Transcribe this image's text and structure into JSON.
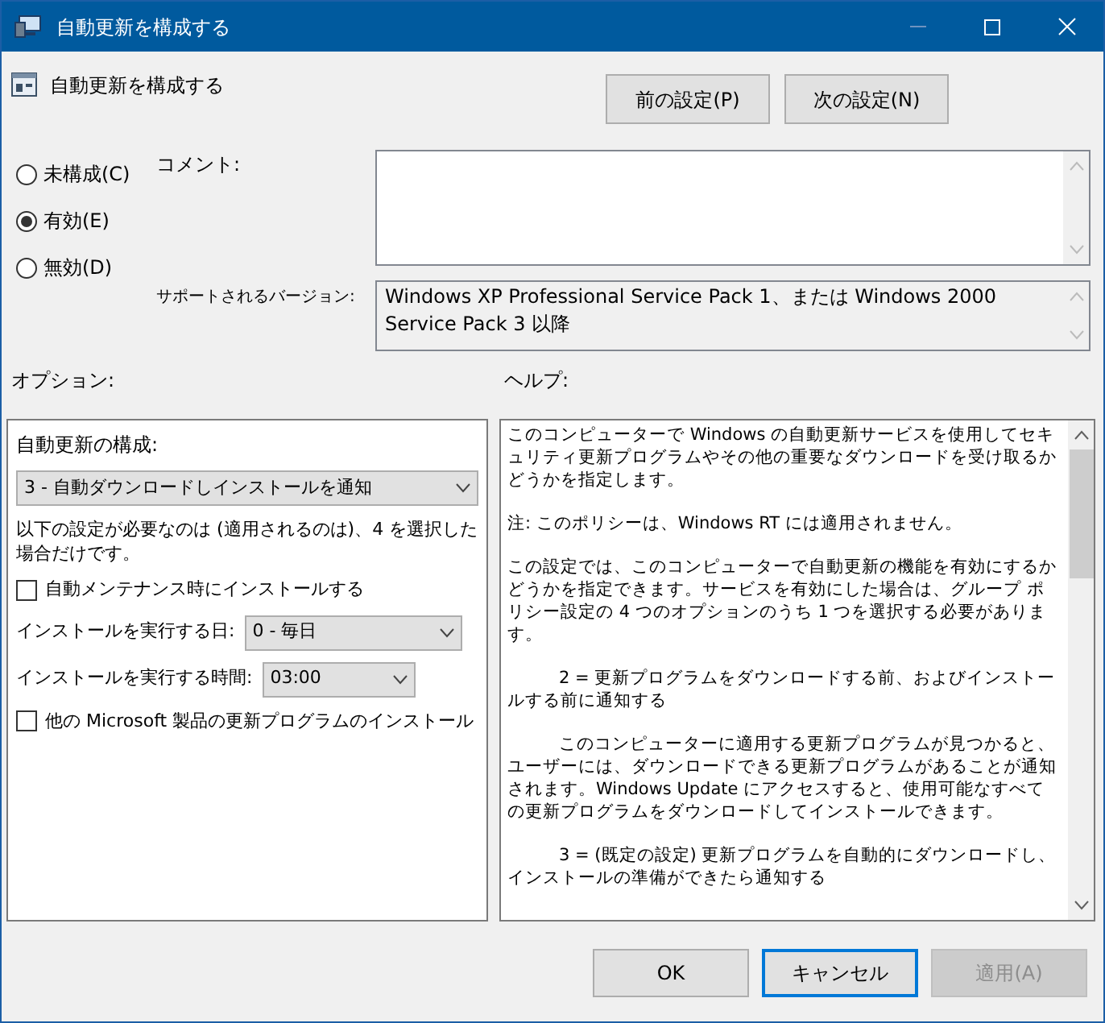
{
  "window": {
    "title": "自動更新を構成する"
  },
  "header": {
    "title": "自動更新を構成する"
  },
  "nav_buttons": [
    {
      "label": "前の設定(P)"
    },
    {
      "label": "次の設定(N)"
    }
  ],
  "state_options": [
    {
      "label": "未構成(C)",
      "selected": false
    },
    {
      "label": "有効(E)",
      "selected": true
    },
    {
      "label": "無効(D)",
      "selected": false
    }
  ],
  "comment": {
    "label": "コメント:"
  },
  "supported": {
    "label": "サポートされるバージョン:",
    "value": "Windows XP Professional Service Pack 1、または Windows 2000 Service Pack 3 以降"
  },
  "options": {
    "label": "オプション:",
    "items": [
      {
        "kind": "label",
        "text": "自動更新の構成:"
      },
      {
        "kind": "dropdown",
        "value": "3 - 自動ダウンロードしインストールを通知"
      },
      {
        "kind": "text",
        "text": "以下の設定が必要なのは (適用されるのは)、4 を選択した場合だけです。"
      },
      {
        "kind": "checkbox",
        "text": "自動メンテナンス時にインストールする",
        "checked": false
      },
      {
        "kind": "labeled_dropdown",
        "text": "インストールを実行する日:",
        "value": "0 - 毎日"
      },
      {
        "kind": "labeled_dropdown",
        "text": "インストールを実行する時間:",
        "value": "03:00"
      },
      {
        "kind": "checkbox",
        "text": "他の Microsoft 製品の更新プログラムのインストール",
        "checked": false
      }
    ]
  },
  "help": {
    "label": "ヘルプ:",
    "paragraphs": [
      {
        "text": "このコンピューターで Windows の自動更新サービスを使用してセキュリティ更新プログラムやその他の重要なダウンロードを受け取るかどうかを指定します。",
        "indented": false
      },
      {
        "text": "注: このポリシーは、Windows RT には適用されません。",
        "indented": false
      },
      {
        "text": "この設定では、このコンピューターで自動更新の機能を有効にするかどうかを指定できます。サービスを有効にした場合は、グループ ポリシー設定の 4 つのオプションのうち 1 つを選択する必要があります。",
        "indented": false
      },
      {
        "text": "2 = 更新プログラムをダウンロードする前、およびインストールする前に通知する",
        "indented": true
      },
      {
        "text": "このコンピューターに適用する更新プログラムが見つかると、ユーザーには、ダウンロードできる更新プログラムがあることが通知されます。Windows Update にアクセスすると、使用可能なすべての更新プログラムをダウンロードしてインストールできます。",
        "indented": true
      },
      {
        "text": "3 = (既定の設定) 更新プログラムを自動的にダウンロードし、インストールの準備ができたら通知する",
        "indented": true
      }
    ]
  },
  "footer_buttons": [
    {
      "label": "OK",
      "focused": false,
      "disabled": false
    },
    {
      "label": "キャンセル",
      "focused": true,
      "disabled": false
    },
    {
      "label": "適用(A)",
      "focused": false,
      "disabled": true
    }
  ]
}
